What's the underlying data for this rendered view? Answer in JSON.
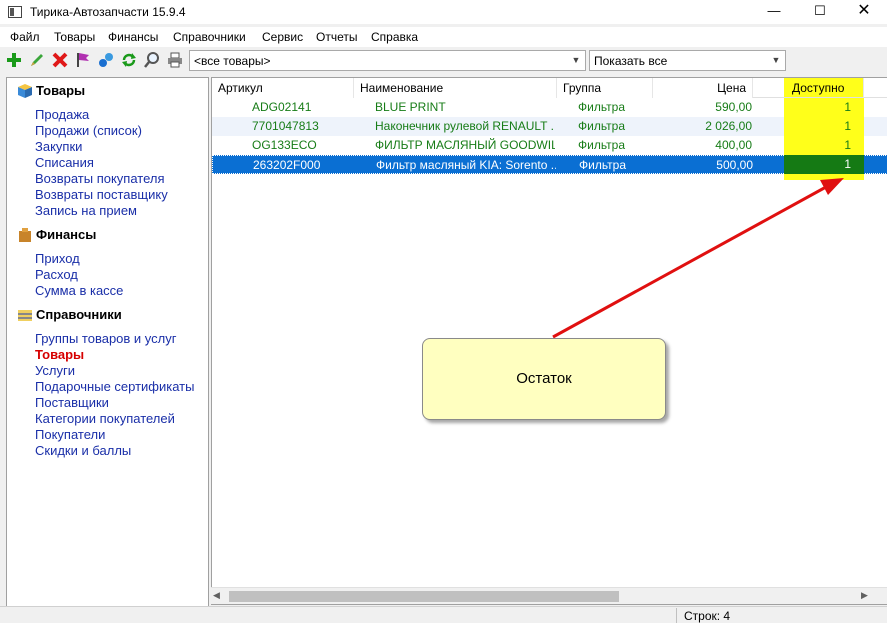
{
  "window": {
    "title": "Тирика-Автозапчасти 15.9.4",
    "minimize": "—",
    "maximize": "☐",
    "close": "✕"
  },
  "menu": [
    "Файл",
    "Товары",
    "Финансы",
    "Справочники",
    "Сервис",
    "Отчеты",
    "Справка"
  ],
  "toolbar": {
    "icons": [
      "add-icon",
      "edit-icon",
      "delete-icon",
      "flag-icon",
      "link-icon",
      "refresh-icon",
      "search-icon",
      "print-icon"
    ],
    "filter_combo": "<все товары>",
    "show_combo": "Показать все"
  },
  "sidebar": {
    "sections": [
      {
        "title": "Товары",
        "icon": "box-icon",
        "items": [
          "Продажа",
          "Продажи (список)",
          "Закупки",
          "Списания",
          "Возвраты покупателя",
          "Возвраты поставщику",
          "Запись на прием"
        ]
      },
      {
        "title": "Финансы",
        "icon": "wallet-icon",
        "items": [
          "Приход",
          "Расход",
          "Сумма в кассе"
        ]
      },
      {
        "title": "Справочники",
        "icon": "books-icon",
        "items": [
          "Группы товаров и услуг",
          "Товары",
          "Услуги",
          "Подарочные сертификаты",
          "Поставщики",
          "Категории покупателей",
          "Покупатели",
          "Скидки и баллы"
        ]
      }
    ],
    "active_item": "Товары"
  },
  "grid": {
    "columns": [
      "Артикул",
      "Наименование",
      "Группа",
      "Цена",
      "Доступно"
    ],
    "rows": [
      [
        "ADG02141",
        "BLUE PRINT",
        "Фильтра",
        "590,00",
        "1"
      ],
      [
        "7701047813",
        "Наконечник рулевой RENAULT ...",
        "Фильтра",
        "2 026,00",
        "1"
      ],
      [
        "OG133ECO",
        "ФИЛЬТР МАСЛЯНЫЙ GOODWILL",
        "Фильтра",
        "400,00",
        "1"
      ],
      [
        "263202F000",
        "Фильтр масляный KIA: Sorento ...",
        "Фильтра",
        "500,00",
        "1"
      ]
    ],
    "selected_row": 3
  },
  "status": {
    "rows_count": "Строк: 4"
  },
  "callout": {
    "text": "Остаток"
  },
  "colors": {
    "highlight_yellow": "#ffff1a",
    "selection_blue": "#0a6fd3",
    "text_green": "#177c17",
    "arrow_red": "#e01010",
    "callout_bg": "#ffffc0"
  }
}
